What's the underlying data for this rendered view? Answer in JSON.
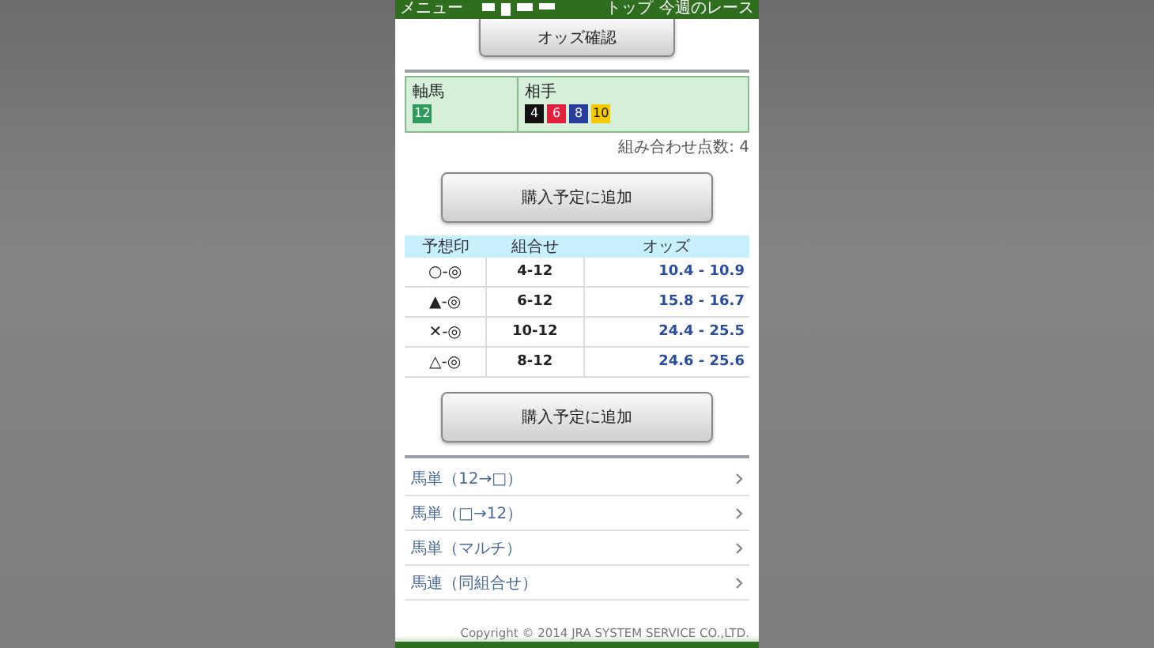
{
  "header": {
    "menu": "メニュー",
    "links": [
      "トップ",
      "今週のレース"
    ]
  },
  "odds_button": "オッズ確認",
  "selection": {
    "axis_label": "軸馬",
    "axis": [
      {
        "number": "12",
        "color": "#2e9a5c"
      }
    ],
    "partner_label": "相手",
    "partners": [
      {
        "number": "4",
        "color": "#111111"
      },
      {
        "number": "6",
        "color": "#e0203c"
      },
      {
        "number": "8",
        "color": "#2c3e9c"
      },
      {
        "number": "10",
        "color": "#f5c800"
      }
    ]
  },
  "combination_count": "組み合わせ点数: 4",
  "add_button_top": "購入予定に追加",
  "table": {
    "columns": [
      "予想印",
      "組合せ",
      "オッズ"
    ],
    "rows": [
      {
        "mark": "○-◎",
        "combination": "4-12",
        "odds": "10.4 - 10.9"
      },
      {
        "mark": "▲-◎",
        "combination": "6-12",
        "odds": "15.8 - 16.7"
      },
      {
        "mark": "✕-◎",
        "combination": "10-12",
        "odds": "24.4 - 25.5"
      },
      {
        "mark": "△-◎",
        "combination": "8-12",
        "odds": "24.6 - 25.6"
      }
    ]
  },
  "add_button_bottom": "購入予定に追加",
  "links": [
    "馬単（12→□）",
    "馬単（□→12）",
    "馬単（マルチ）",
    "馬連（同組合せ）"
  ],
  "copyright": "Copyright © 2014 JRA SYSTEM SERVICE CO.,LTD."
}
